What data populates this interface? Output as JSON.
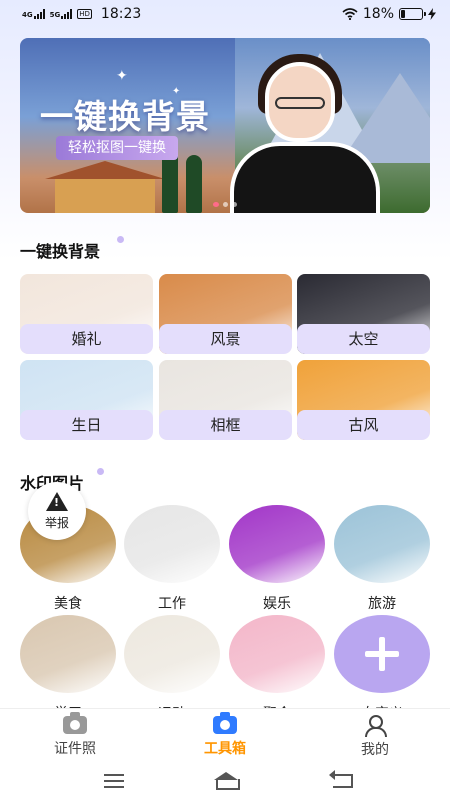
{
  "status_bar": {
    "net1": "4G",
    "net2": "5G",
    "hd": "HD",
    "time": "18:23",
    "battery": "18%",
    "battery_level": 0.18
  },
  "banner": {
    "title": "一键换背景",
    "subtitle": "轻松抠图一键换",
    "page_count": 3,
    "active_index": 0
  },
  "background_section": {
    "title": "一键换背景",
    "items": [
      {
        "label": "婚礼",
        "color": "#f2e6dc"
      },
      {
        "label": "风景",
        "color": "#d98b4a"
      },
      {
        "label": "太空",
        "color": "#2a2a33"
      },
      {
        "label": "生日",
        "color": "#cfe3f3"
      },
      {
        "label": "相框",
        "color": "#e9e5e0"
      },
      {
        "label": "古风",
        "color": "#f0a23a"
      }
    ]
  },
  "watermark_section": {
    "title": "水印图片",
    "items": [
      {
        "label": "美食",
        "color": "#b8893f"
      },
      {
        "label": "工作",
        "color": "#e6e6e6"
      },
      {
        "label": "娱乐",
        "color": "#a236c8"
      },
      {
        "label": "旅游",
        "color": "#9cc3d8"
      },
      {
        "label": "学习",
        "color": "#d9c7b0"
      },
      {
        "label": "运动",
        "color": "#ede8df"
      },
      {
        "label": "聚会",
        "color": "#f3b6c9"
      },
      {
        "label": "自定义",
        "color": "#b9a6f0",
        "icon": "plus-icon"
      }
    ]
  },
  "report": {
    "label": "举报",
    "icon": "warning-icon"
  },
  "tab_bar": {
    "tabs": [
      {
        "label": "证件照",
        "icon": "camera-icon"
      },
      {
        "label": "工具箱",
        "icon": "camera-icon",
        "active": true
      },
      {
        "label": "我的",
        "icon": "person-icon"
      }
    ],
    "active_color": "#ff9500"
  },
  "nav_bar": {
    "icons": [
      "menu-icon",
      "home-icon",
      "back-icon"
    ]
  }
}
